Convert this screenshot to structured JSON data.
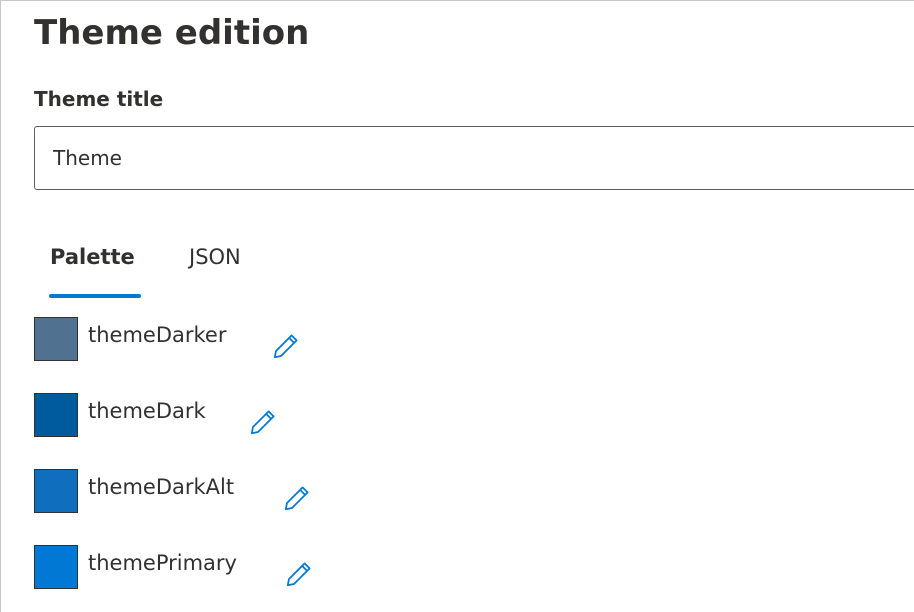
{
  "page": {
    "title": "Theme edition"
  },
  "theme_title": {
    "label": "Theme title",
    "value": "Theme"
  },
  "tabs": [
    {
      "label": "Palette",
      "selected": true
    },
    {
      "label": "JSON",
      "selected": false
    }
  ],
  "accent_color": "#0078d4",
  "palette": [
    {
      "name": "themeDarker",
      "color": "#517190",
      "edit_icon": "pencil-icon"
    },
    {
      "name": "themeDark",
      "color": "#005a9e",
      "edit_icon": "pencil-icon"
    },
    {
      "name": "themeDarkAlt",
      "color": "#106ebe",
      "edit_icon": "pencil-icon"
    },
    {
      "name": "themePrimary",
      "color": "#0078d4",
      "edit_icon": "pencil-icon"
    }
  ]
}
